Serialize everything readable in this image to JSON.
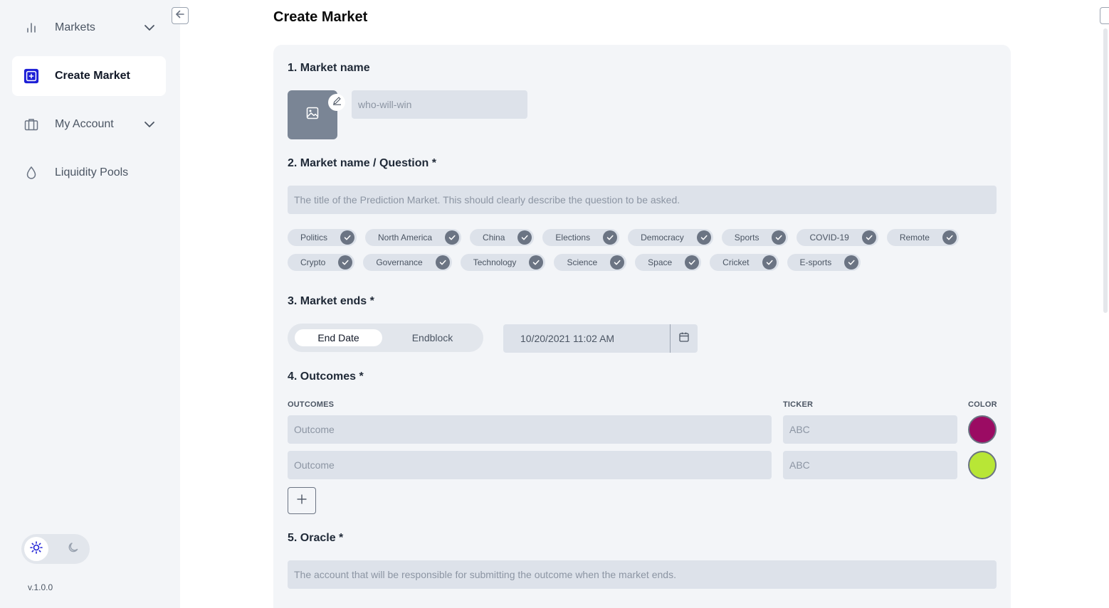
{
  "sidebar": {
    "items": [
      {
        "label": "Markets",
        "icon": "bar-chart-icon"
      },
      {
        "label": "Create Market",
        "icon": "plus-square-icon",
        "active": true
      },
      {
        "label": "My Account",
        "icon": "briefcase-icon"
      },
      {
        "label": "Liquidity Pools",
        "icon": "droplet-icon"
      }
    ],
    "version": "v.1.0.0"
  },
  "page": {
    "title": "Create Market"
  },
  "form": {
    "s1": {
      "title": "1. Market name",
      "slug_placeholder": "who-will-win"
    },
    "s2": {
      "title": "2. Market name / Question *",
      "question_placeholder": "The title of the Prediction Market. This should clearly describe the question to be asked."
    },
    "tags_row1": [
      "Politics",
      "North America",
      "China",
      "Elections",
      "Democracy",
      "Sports",
      "COVID-19",
      "Remote"
    ],
    "tags_row2": [
      "Crypto",
      "Governance",
      "Technology",
      "Science",
      "Space",
      "Cricket",
      "E-sports"
    ],
    "s3": {
      "title": "3. Market ends *",
      "end_date_label": "End Date",
      "endblock_label": "Endblock",
      "date_value": "10/20/2021 11:02 AM"
    },
    "s4": {
      "title": "4. Outcomes *",
      "col_outcomes": "OUTCOMES",
      "col_ticker": "TICKER",
      "col_color": "COLOR",
      "rows": [
        {
          "outcome_placeholder": "Outcome",
          "ticker_placeholder": "ABC",
          "color": "#9b0b63"
        },
        {
          "outcome_placeholder": "Outcome",
          "ticker_placeholder": "ABC",
          "color": "#b8e636"
        }
      ]
    },
    "s5": {
      "title": "5. Oracle *",
      "oracle_placeholder": "The account that will be responsible for submitting the outcome when the market ends."
    }
  },
  "colors": {
    "accent": "#1d1fd6",
    "sidebar_bg": "#f3f5f8",
    "card_bg": "#f3f5f8",
    "input_bg": "#dde2ea"
  }
}
